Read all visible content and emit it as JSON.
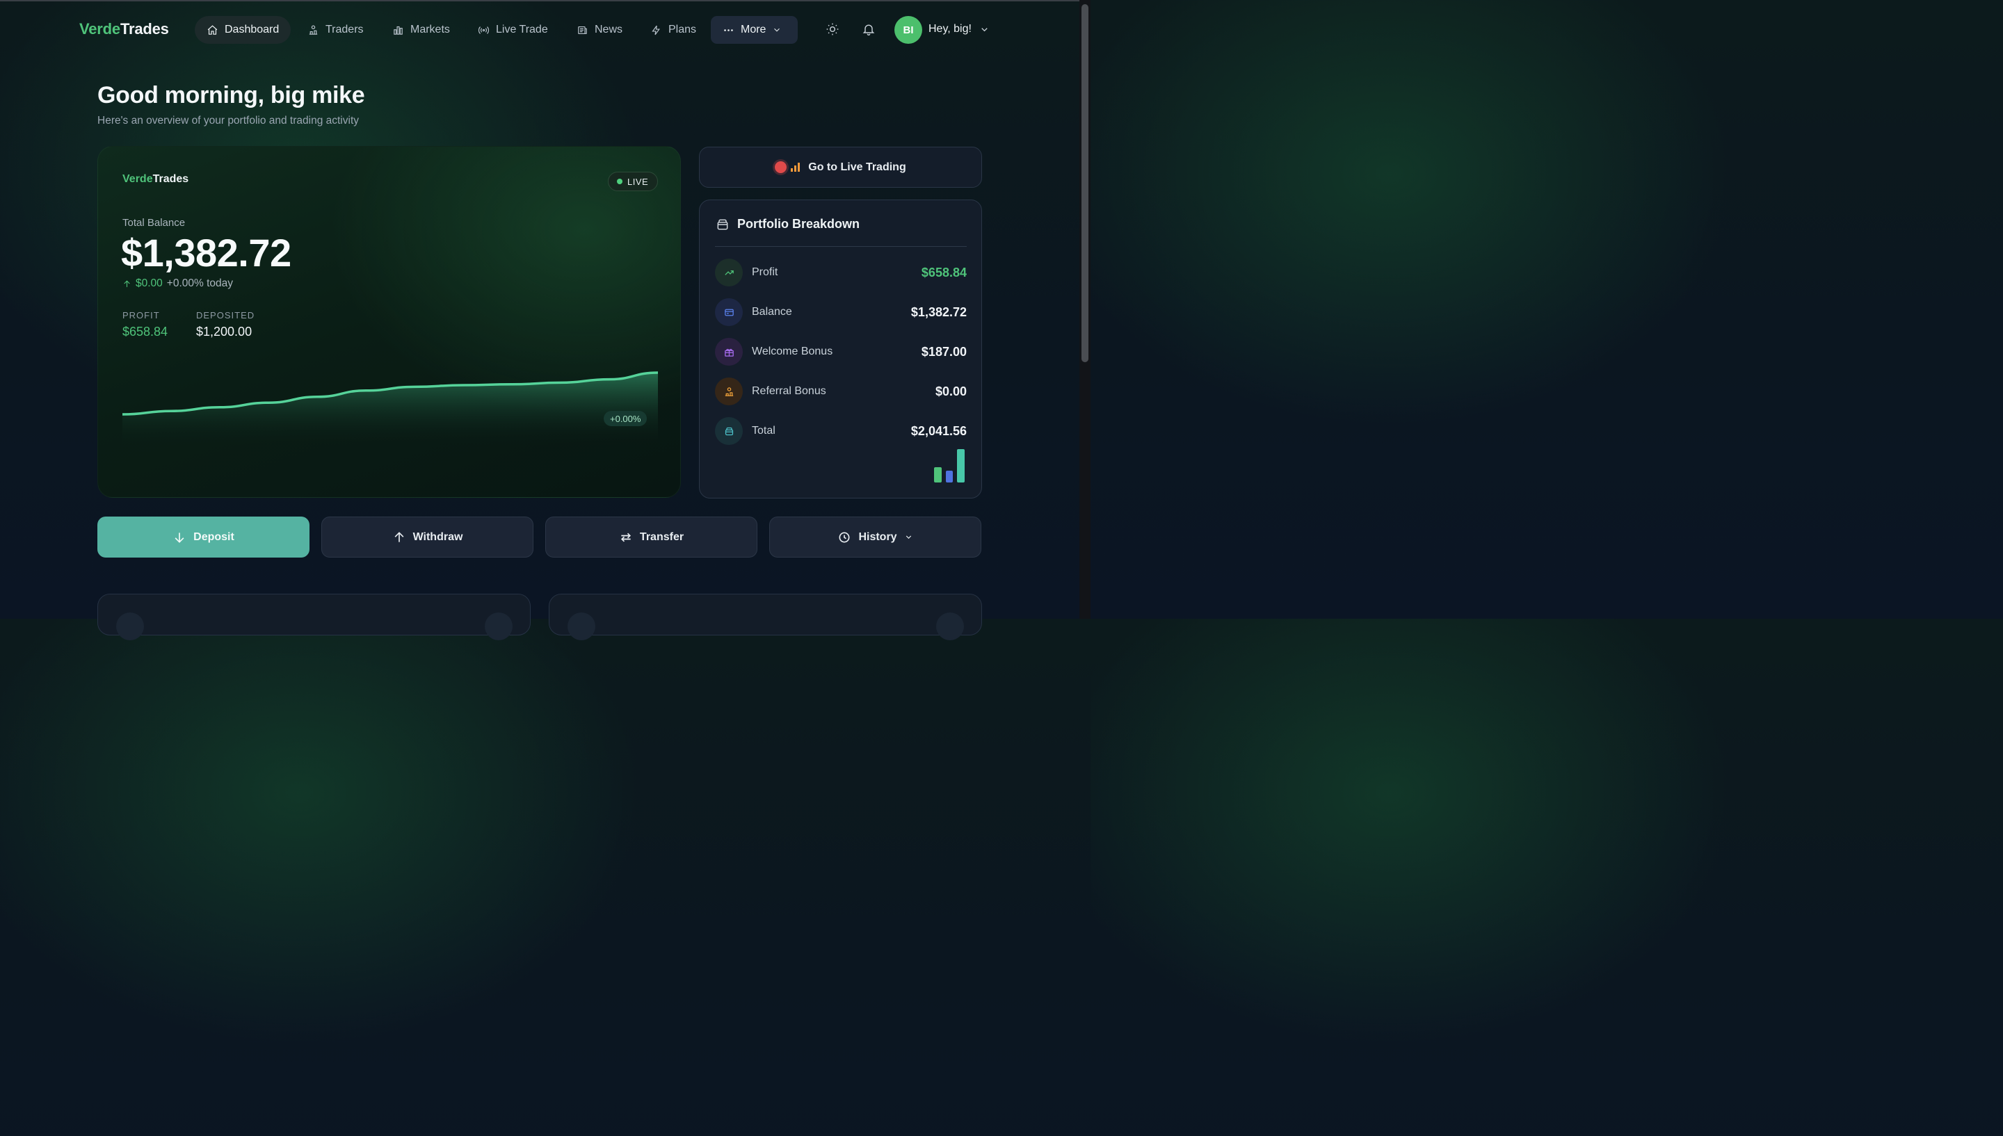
{
  "brand": {
    "part1": "Verde",
    "part2": "Trades"
  },
  "nav": {
    "items": [
      {
        "label": "Dashboard",
        "icon": "home-icon",
        "active": true
      },
      {
        "label": "Traders",
        "icon": "traders-icon"
      },
      {
        "label": "Markets",
        "icon": "bar-chart-icon"
      },
      {
        "label": "Live Trade",
        "icon": "broadcast-icon"
      },
      {
        "label": "News",
        "icon": "newspaper-icon"
      },
      {
        "label": "Plans",
        "icon": "lightning-icon"
      }
    ],
    "more_label": "More",
    "user_initials": "BI",
    "user_greeting": "Hey, big!"
  },
  "header": {
    "greeting": "Good morning, big mike",
    "subtitle": "Here's an overview of your portfolio and trading activity"
  },
  "balance_card": {
    "live_label": "LIVE",
    "total_label": "Total Balance",
    "total_value": "$1,382.72",
    "change_amount": "$0.00",
    "change_pct": "+0.00% today",
    "profit_label": "PROFIT",
    "profit_value": "$658.84",
    "deposited_label": "DEPOSITED",
    "deposited_value": "$1,200.00",
    "chart_badge": "+0.00%"
  },
  "chart_data": {
    "type": "area",
    "values": [
      0,
      8,
      17,
      28,
      42,
      57,
      66,
      70,
      72,
      76,
      84,
      100
    ],
    "color": "#56d39a"
  },
  "live_trading_button": "Go to Live Trading",
  "portfolio": {
    "title": "Portfolio Breakdown",
    "rows": [
      {
        "label": "Profit",
        "value": "$658.84",
        "icon": "trending-up-icon",
        "color": "#4fc37a",
        "bg": "#1c2f2a"
      },
      {
        "label": "Balance",
        "value": "$1,382.72",
        "icon": "credit-card-icon",
        "color": "#5b83f0",
        "bg": "#1d2744"
      },
      {
        "label": "Welcome Bonus",
        "value": "$187.00",
        "icon": "gift-icon",
        "color": "#a86df0",
        "bg": "#2a2140"
      },
      {
        "label": "Referral Bonus",
        "value": "$0.00",
        "icon": "referral-icon",
        "color": "#f0a23a",
        "bg": "#352618"
      },
      {
        "label": "Total",
        "value": "$2,041.56",
        "icon": "wallet-icon",
        "color": "#4cc0c8",
        "bg": "#193038"
      }
    ],
    "mini_bars": [
      {
        "level": 0.45,
        "color": "#4fc37a"
      },
      {
        "level": 0.35,
        "color": "#4f73e0"
      },
      {
        "level": 1.0,
        "color": "#48c7a8"
      }
    ]
  },
  "actions": {
    "deposit": "Deposit",
    "withdraw": "Withdraw",
    "transfer": "Transfer",
    "history": "History"
  }
}
